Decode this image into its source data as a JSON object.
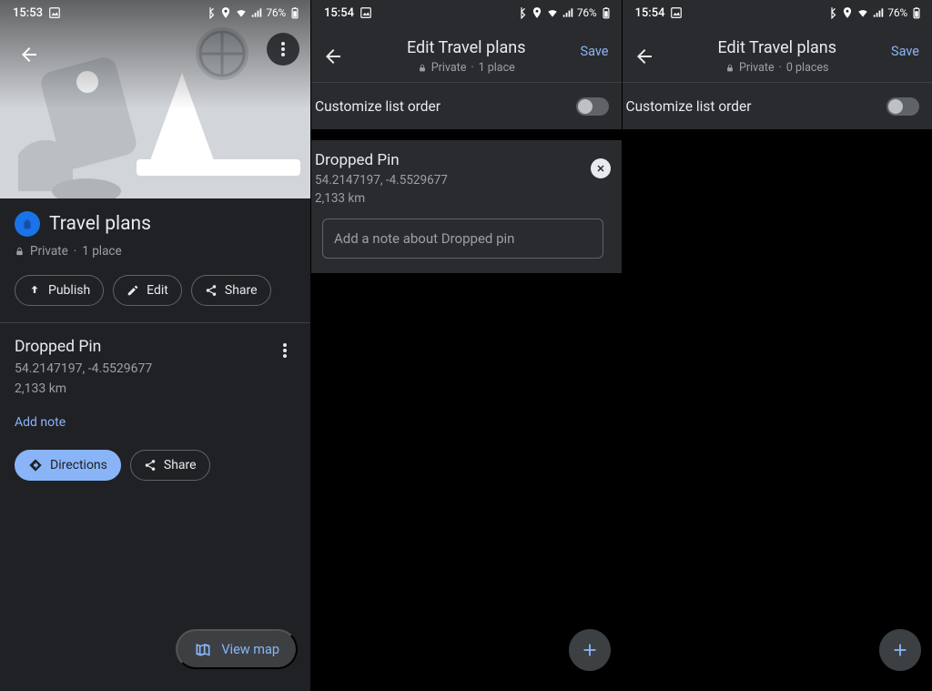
{
  "panel1": {
    "status": {
      "time": "15:53",
      "battery": "76%"
    },
    "list_title": "Travel plans",
    "privacy": "Private",
    "place_count": "1 place",
    "actions": {
      "publish": "Publish",
      "edit": "Edit",
      "share": "Share"
    },
    "place": {
      "title": "Dropped Pin",
      "coords": "54.2147197, -4.5529677",
      "distance": "2,133 km",
      "add_note": "Add note",
      "directions": "Directions",
      "share": "Share"
    },
    "view_map": "View map"
  },
  "panel2": {
    "status": {
      "time": "15:54",
      "battery": "76%"
    },
    "title": "Edit Travel plans",
    "save": "Save",
    "privacy": "Private",
    "place_count": "1 place",
    "customize": "Customize list order",
    "place": {
      "title": "Dropped Pin",
      "coords": "54.2147197, -4.5529677",
      "distance": "2,133 km",
      "note_placeholder": "Add a note about Dropped pin"
    }
  },
  "panel3": {
    "status": {
      "time": "15:54",
      "battery": "76%"
    },
    "title": "Edit Travel plans",
    "save": "Save",
    "privacy": "Private",
    "place_count": "0 places",
    "customize": "Customize list order"
  }
}
